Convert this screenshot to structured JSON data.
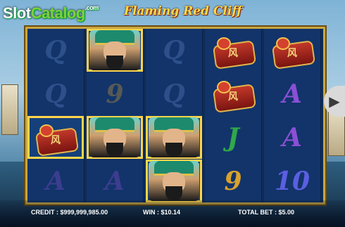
{
  "brand": {
    "slot": "Slot",
    "catalog": "Catalog",
    "com": ".com"
  },
  "game": {
    "title": "Flaming Red Cliff"
  },
  "status": {
    "credit_label": "CREDIT :",
    "credit_value": "$999,999,985.00",
    "win_label": "WIN :",
    "win_value": "$10.14",
    "bet_label": "TOTAL BET :",
    "bet_value": "$5.00"
  },
  "reels": [
    [
      {
        "s": "Q",
        "win": false
      },
      {
        "s": "Q",
        "win": false
      },
      {
        "s": "seal",
        "win": true
      },
      {
        "s": "A",
        "win": false
      }
    ],
    [
      {
        "s": "hero",
        "win": true
      },
      {
        "s": "9",
        "win": false
      },
      {
        "s": "hero",
        "win": true
      },
      {
        "s": "A",
        "win": false
      }
    ],
    [
      {
        "s": "Q",
        "win": false
      },
      {
        "s": "Q",
        "win": false
      },
      {
        "s": "hero",
        "win": true
      },
      {
        "s": "hero",
        "win": true
      }
    ],
    [
      {
        "s": "seal",
        "win": false
      },
      {
        "s": "seal",
        "win": false
      },
      {
        "s": "J",
        "win": false
      },
      {
        "s": "9",
        "win": false
      }
    ],
    [
      {
        "s": "seal",
        "win": false
      },
      {
        "s": "A",
        "win": false
      },
      {
        "s": "A",
        "win": false
      },
      {
        "s": "10",
        "win": false
      }
    ]
  ],
  "seal_glyph": "风"
}
